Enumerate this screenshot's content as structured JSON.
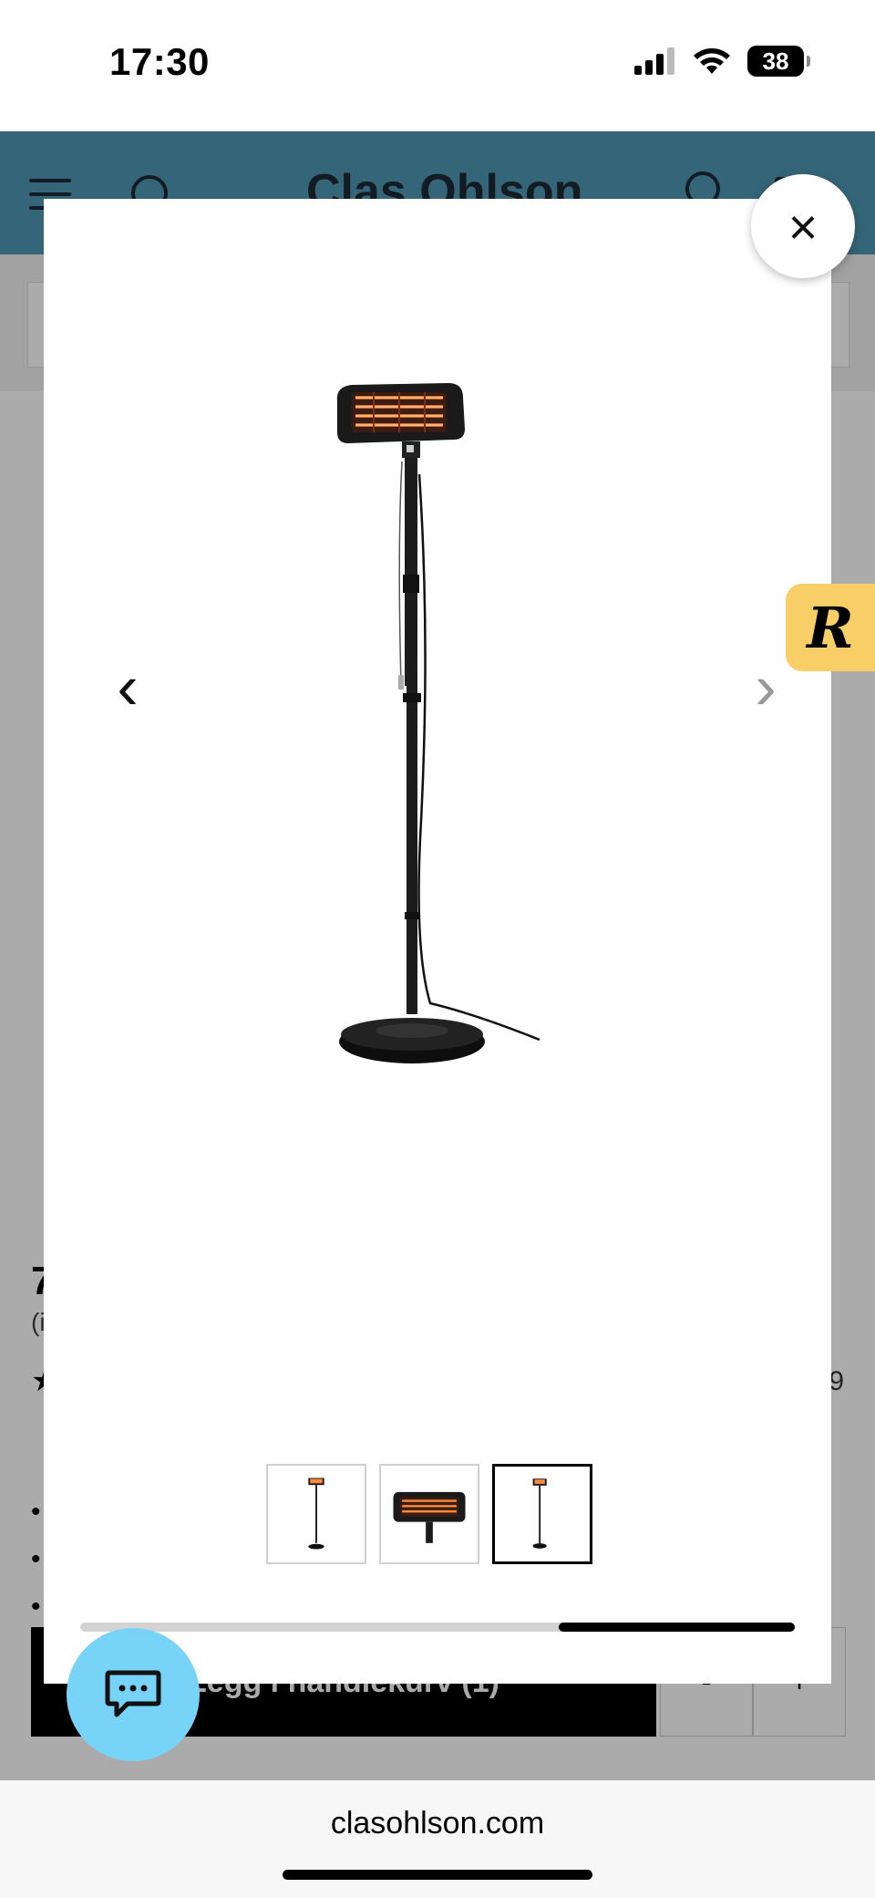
{
  "status_bar": {
    "time": "17:30",
    "battery": "38"
  },
  "header": {
    "logo": "Clas Ohlson"
  },
  "product_page": {
    "price_partial": "7",
    "vat_partial": "(i",
    "review_count_partial": "9",
    "add_to_cart_label": "Legg i handlekurv (1)",
    "qty_minus": "-",
    "qty_plus": "+"
  },
  "gallery": {
    "close_glyph": "×",
    "prev_glyph": "‹",
    "next_glyph": "›",
    "thumbnails": [
      "heater-full",
      "heater-head",
      "heater-full-alt"
    ],
    "active_index": 2,
    "scroll_position": {
      "start": 0.67,
      "end": 1.0
    }
  },
  "badge": {
    "letter": "R"
  },
  "browser": {
    "url": "clasohlson.com"
  },
  "colors": {
    "header": "#4f97b4",
    "chat": "#78d3f8",
    "badge": "#f7cf66"
  }
}
